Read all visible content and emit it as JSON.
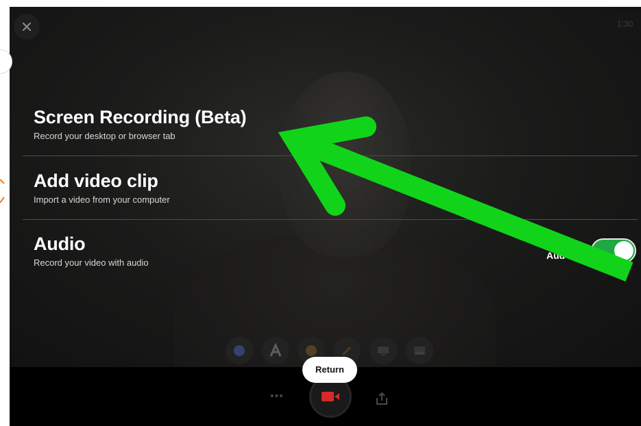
{
  "overlay": {
    "options": [
      {
        "title": "Screen Recording (Beta)",
        "description": "Record your desktop or browser tab"
      },
      {
        "title": "Add video clip",
        "description": "Import a video from your computer"
      },
      {
        "title": "Audio",
        "description": "Record your video with audio"
      }
    ],
    "audio_toggle_label": "Aud",
    "audio_toggle_state": "on"
  },
  "header": {
    "timer": "1:30"
  },
  "footer": {
    "return_label": "Return",
    "more_label": "•••"
  },
  "icons": [
    "close-icon",
    "emoji-icon",
    "text-icon",
    "sticker-icon",
    "pen-icon",
    "screen-icon",
    "image-icon",
    "camera-icon",
    "share-icon"
  ],
  "colors": {
    "accent_green": "#1fa843",
    "arrow_green": "#11d41a",
    "record_red": "#d62a2a",
    "overlay_bg": "#1b1b1a"
  }
}
